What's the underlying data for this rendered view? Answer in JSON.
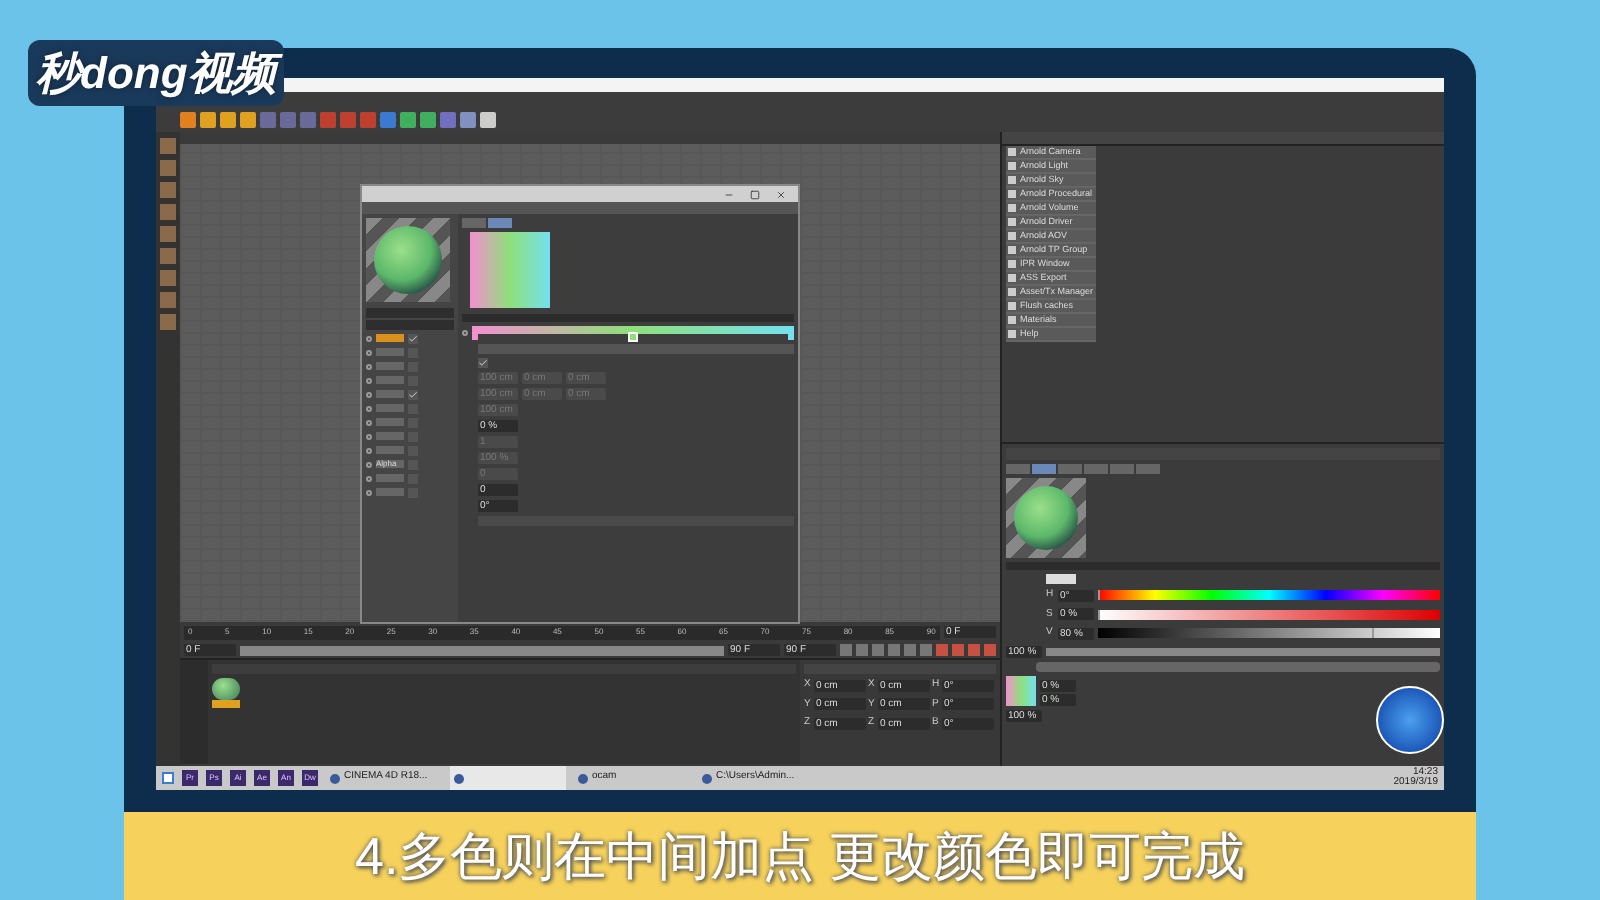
{
  "logo": {
    "text": "秒dong视频"
  },
  "arnold_menu": {
    "items": [
      "Arnold Camera",
      "Arnold Light",
      "Arnold Sky",
      "Arnold Procedural",
      "Arnold Volume",
      "Arnold Driver",
      "Arnold AOV",
      "Arnold TP Group",
      "IPR Window",
      "ASS Export",
      "Asset/Tx Manager",
      "Flush caches",
      "Materials",
      "Help"
    ]
  },
  "material_editor": {
    "channels": [
      {
        "checked": true,
        "selected": true
      },
      {
        "checked": false,
        "selected": false
      },
      {
        "checked": false,
        "selected": false
      },
      {
        "checked": false,
        "selected": false
      },
      {
        "checked": true,
        "selected": false
      },
      {
        "checked": false,
        "selected": false
      },
      {
        "checked": false,
        "selected": false
      },
      {
        "checked": false,
        "selected": false
      },
      {
        "checked": false,
        "selected": false
      },
      {
        "label": "Alpha",
        "checked": false,
        "selected": false
      },
      {
        "checked": false,
        "selected": false
      },
      {
        "checked": false,
        "selected": false
      }
    ],
    "tabs": [
      {
        "selected": false
      },
      {
        "selected": true
      }
    ],
    "gradient_knots": [
      {
        "color": "#f48fd0",
        "selected": false
      },
      {
        "color": "#8ee07a",
        "selected": true
      },
      {
        "color": "#74e0f0",
        "selected": false
      }
    ],
    "cycle_checked": true,
    "params": [
      {
        "fields": [
          "100 cm",
          "0 cm",
          "0 cm"
        ],
        "disabled": true
      },
      {
        "fields": [
          "100 cm",
          "0 cm",
          "0 cm"
        ],
        "disabled": true
      },
      {
        "fields": [
          "100 cm"
        ],
        "disabled": true
      },
      {
        "fields": [
          "0 %"
        ],
        "disabled": false
      },
      {
        "fields": [
          "1"
        ],
        "disabled": true
      },
      {
        "fields": [
          "100 %"
        ],
        "disabled": true
      },
      {
        "fields": [
          "0"
        ],
        "disabled": true
      },
      {
        "fields": [
          "0"
        ],
        "disabled": false
      },
      {
        "fields": [
          "0°"
        ],
        "disabled": false
      }
    ]
  },
  "timeline": {
    "ticks": [
      "0",
      "5",
      "10",
      "15",
      "20",
      "25",
      "30",
      "35",
      "40",
      "45",
      "50",
      "55",
      "60",
      "65",
      "70",
      "75",
      "80",
      "85",
      "90"
    ],
    "frame": "0 F",
    "fields": [
      "0 F",
      "90 F",
      "90 F"
    ],
    "range": {
      "level": 1
    }
  },
  "coordinates": {
    "rows": [
      {
        "axes": [
          "X",
          "X",
          "H"
        ],
        "values": [
          "0 cm",
          "0 cm",
          "0°"
        ]
      },
      {
        "axes": [
          "Y",
          "Y",
          "P"
        ],
        "values": [
          "0 cm",
          "0 cm",
          "0°"
        ]
      },
      {
        "axes": [
          "Z",
          "Z",
          "B"
        ],
        "values": [
          "0 cm",
          "0 cm",
          "0°"
        ]
      }
    ]
  },
  "attributes": {
    "tabs": [
      {
        "selected": false
      },
      {
        "selected": true
      },
      {
        "selected": false
      },
      {
        "selected": false
      },
      {
        "selected": false
      },
      {
        "selected": false
      }
    ],
    "hsv": [
      {
        "axis": "H",
        "value": "0°",
        "level": 0
      },
      {
        "axis": "S",
        "value": "0 %",
        "level": 0
      },
      {
        "axis": "V",
        "value": "80 %",
        "level": 0.8
      }
    ],
    "brightness": {
      "value": "100 %",
      "level": 1
    },
    "mix": [
      "0 %",
      "0 %"
    ],
    "mix_strength": "100 %"
  },
  "taskbar": {
    "apps": [
      "Pr",
      "Ps",
      "Ai",
      "Ae",
      "An",
      "Dw"
    ],
    "windows": [
      {
        "label": "CINEMA 4D R18...",
        "selected": false
      },
      {
        "selected": true
      },
      {
        "label": "ocam",
        "selected": false
      },
      {
        "label": "C:\\Users\\Admin...",
        "selected": false
      }
    ],
    "time": "14:23",
    "date": "2019/3/19"
  },
  "subtitle": "4.多色则在中间加点 更改颜色即可完成"
}
